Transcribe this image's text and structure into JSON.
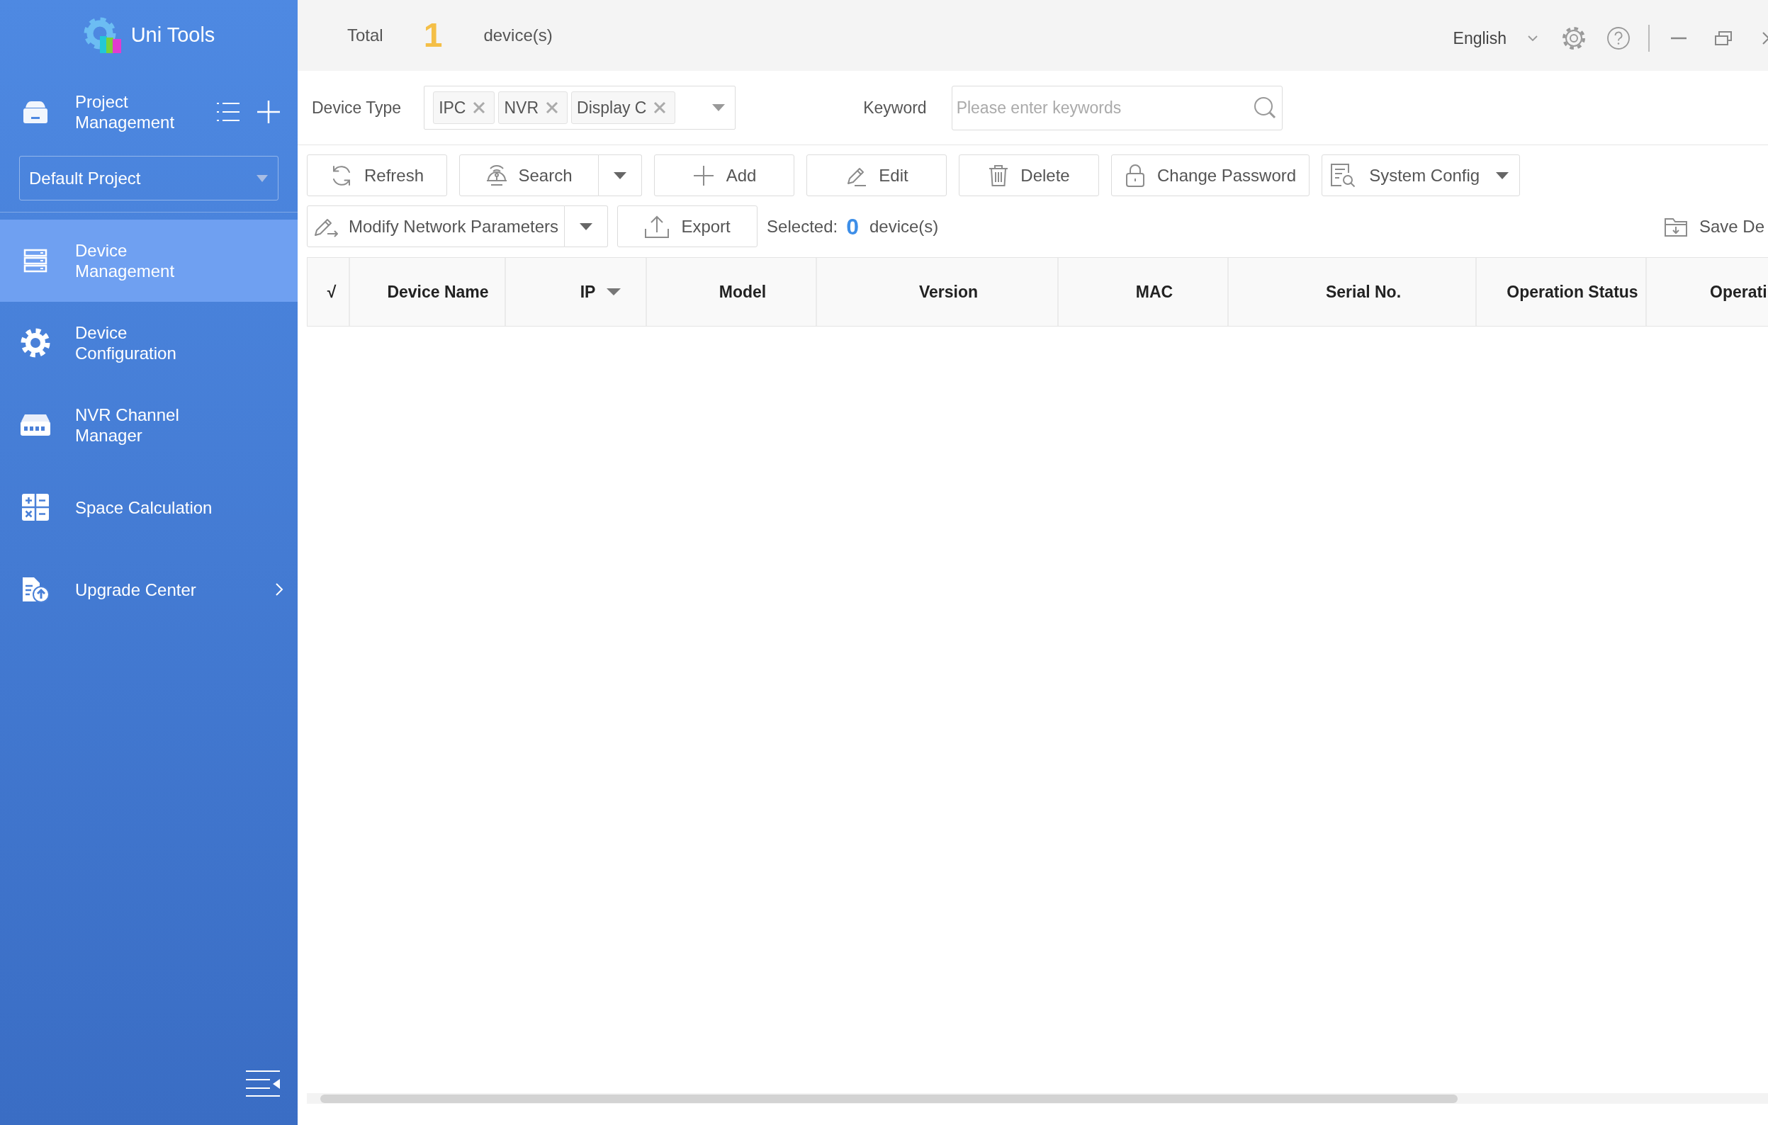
{
  "app": {
    "name": "Uni Tools"
  },
  "sidebar": {
    "project": {
      "title": "Project Management",
      "current": "Default Project"
    },
    "items": [
      {
        "label": "Device Management",
        "selected": true,
        "expandable": false
      },
      {
        "label": "Device Configuration",
        "selected": false,
        "expandable": false
      },
      {
        "label": "NVR Channel Manager",
        "selected": false,
        "expandable": false
      },
      {
        "label": "Space Calculation",
        "selected": false,
        "expandable": false
      },
      {
        "label": "Upgrade Center",
        "selected": false,
        "expandable": true
      }
    ]
  },
  "top_bar": {
    "total_label": "Total",
    "total_count": "1",
    "total_unit": "device(s)",
    "language": "English"
  },
  "filters": {
    "device_type": {
      "label": "Device Type",
      "tags": [
        "IPC",
        "NVR",
        "Display C"
      ]
    },
    "keyword": {
      "label": "Keyword",
      "placeholder": "Please enter keywords"
    }
  },
  "toolbar": {
    "row_1": [
      {
        "label": "Refresh",
        "kind": "plain"
      },
      {
        "label": "Search",
        "kind": "split"
      },
      {
        "label": "Add",
        "kind": "plain"
      },
      {
        "label": "Edit",
        "kind": "plain"
      },
      {
        "label": "Delete",
        "kind": "plain"
      },
      {
        "label": "Change Password",
        "kind": "plain"
      },
      {
        "label": "System Config",
        "kind": "menu"
      }
    ],
    "row_2": [
      {
        "label": "Modify Network Parameters",
        "kind": "split"
      },
      {
        "label": "Export",
        "kind": "plain"
      }
    ],
    "selection": {
      "label": "Selected:",
      "count": "0",
      "unit": "device(s)"
    },
    "save_link": "Save De"
  },
  "table": {
    "columns": [
      {
        "label": "√",
        "dropdown": false
      },
      {
        "label": "Device Name",
        "dropdown": false
      },
      {
        "label": "IP",
        "dropdown": true
      },
      {
        "label": "Model",
        "dropdown": false
      },
      {
        "label": "Version",
        "dropdown": false
      },
      {
        "label": "MAC",
        "dropdown": false
      },
      {
        "label": "Serial No.",
        "dropdown": false
      },
      {
        "label": "Operation Status",
        "dropdown": false
      },
      {
        "label": "Operati",
        "dropdown": false
      }
    ]
  }
}
